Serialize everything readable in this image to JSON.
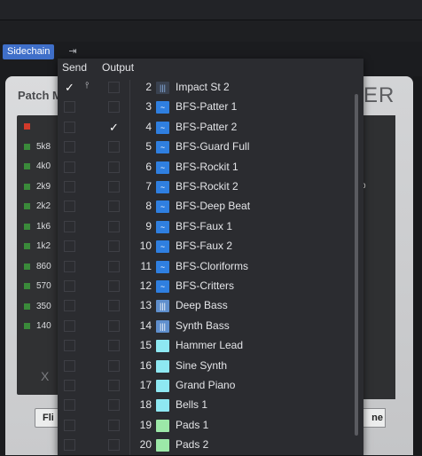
{
  "tabs": {
    "sidechain_label": "Sidechain",
    "routing_icon": "routing-arrow-icon"
  },
  "device_left": {
    "title": "Patch M",
    "meter_labels": [
      "",
      "5k8",
      "4k0",
      "2k9",
      "2k2",
      "1k6",
      "1k2",
      "860",
      "570",
      "350",
      "140"
    ],
    "x_label": "X",
    "button_label": "Fli"
  },
  "device_right": {
    "title": "ER",
    "button_label": "ne",
    "screw": "b"
  },
  "popup": {
    "send_header": "Send",
    "output_header": "Output",
    "rows": [
      {
        "num": "2",
        "name": "Impact St 2",
        "icon": "instrument-icon",
        "color": "dark",
        "send_checked": true,
        "output_checked": false,
        "routing_icon": true
      },
      {
        "num": "3",
        "name": "BFS-Patter 1",
        "icon": "pattern-icon",
        "color": "blue",
        "send_checked": false,
        "output_checked": false
      },
      {
        "num": "4",
        "name": "BFS-Patter 2",
        "icon": "pattern-icon",
        "color": "blue",
        "send_checked": false,
        "output_checked": true
      },
      {
        "num": "5",
        "name": "BFS-Guard Full",
        "icon": "pattern-icon",
        "color": "blue",
        "send_checked": false,
        "output_checked": false
      },
      {
        "num": "6",
        "name": "BFS-Rockit 1",
        "icon": "pattern-icon",
        "color": "blue",
        "send_checked": false,
        "output_checked": false
      },
      {
        "num": "7",
        "name": "BFS-Rockit 2",
        "icon": "pattern-icon",
        "color": "blue",
        "send_checked": false,
        "output_checked": false
      },
      {
        "num": "8",
        "name": "BFS-Deep Beat",
        "icon": "pattern-icon",
        "color": "blue",
        "send_checked": false,
        "output_checked": false
      },
      {
        "num": "9",
        "name": "BFS-Faux 1",
        "icon": "pattern-icon",
        "color": "blue",
        "send_checked": false,
        "output_checked": false
      },
      {
        "num": "10",
        "name": "BFS-Faux 2",
        "icon": "pattern-icon",
        "color": "blue",
        "send_checked": false,
        "output_checked": false
      },
      {
        "num": "11",
        "name": "BFS-Cloriforms",
        "icon": "pattern-icon",
        "color": "blue",
        "send_checked": false,
        "output_checked": false
      },
      {
        "num": "12",
        "name": "BFS-Critters",
        "icon": "pattern-icon",
        "color": "blue",
        "send_checked": false,
        "output_checked": false
      },
      {
        "num": "13",
        "name": "Deep Bass",
        "icon": "keyboard-icon",
        "color": "lblue",
        "send_checked": false,
        "output_checked": false
      },
      {
        "num": "14",
        "name": "Synth Bass",
        "icon": "keyboard-icon",
        "color": "lblue",
        "send_checked": false,
        "output_checked": false
      },
      {
        "num": "15",
        "name": "Hammer Lead",
        "icon": "color-swatch-icon",
        "color": "cyan",
        "send_checked": false,
        "output_checked": false
      },
      {
        "num": "16",
        "name": "Sine Synth",
        "icon": "color-swatch-icon",
        "color": "cyan",
        "send_checked": false,
        "output_checked": false
      },
      {
        "num": "17",
        "name": "Grand Piano",
        "icon": "color-swatch-icon",
        "color": "cyan",
        "send_checked": false,
        "output_checked": false
      },
      {
        "num": "18",
        "name": "Bells 1",
        "icon": "color-swatch-icon",
        "color": "cyan",
        "send_checked": false,
        "output_checked": false
      },
      {
        "num": "19",
        "name": "Pads 1",
        "icon": "color-swatch-icon",
        "color": "green",
        "send_checked": false,
        "output_checked": false
      },
      {
        "num": "20",
        "name": "Pads 2",
        "icon": "color-swatch-icon",
        "color": "green",
        "send_checked": false,
        "output_checked": false
      }
    ]
  }
}
